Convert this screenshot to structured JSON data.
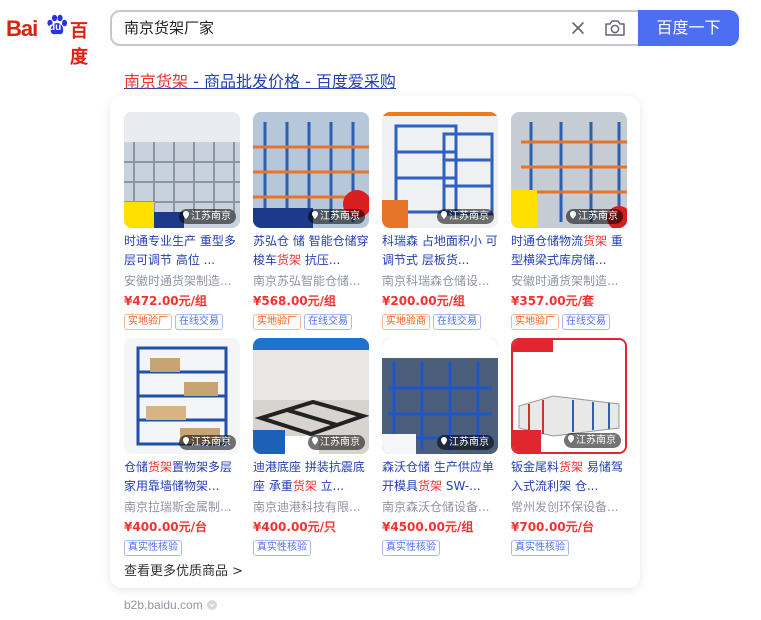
{
  "header": {
    "logo_text_en": "Bai",
    "logo_paw_text": "du",
    "logo_text_cn": "百度",
    "search_value": "南京货架厂家",
    "search_button": "百度一下"
  },
  "result": {
    "title_highlight": "南京货架",
    "title_rest": " - 商品批发价格 - 百度爱采购",
    "more_link": "查看更多优质商品 >",
    "source": "b2b.baidu.com"
  },
  "products": [
    {
      "title_a": "时通专业生产 重型多层可调节 高位 ...",
      "title_hl": "",
      "title_b": "",
      "company": "安徽时通货架制造...",
      "price": "¥472.00元/组",
      "location": "江苏南京",
      "tags": [
        "实地验厂",
        "在线交易"
      ],
      "tag_styles": [
        "orange",
        "blue"
      ]
    },
    {
      "title_a": "苏弘仓 储 智能仓储穿梭车",
      "title_hl": "货架",
      "title_b": " 抗压...",
      "company": "南京苏弘智能仓储...",
      "price": "¥568.00元/组",
      "location": "江苏南京",
      "tags": [
        "实地验厂",
        "在线交易"
      ],
      "tag_styles": [
        "orange",
        "blue"
      ]
    },
    {
      "title_a": "科瑞森 占地面积小 可调节式 层板货...",
      "title_hl": "",
      "title_b": "",
      "company": "南京科瑞森仓储设...",
      "price": "¥200.00元/组",
      "location": "江苏南京",
      "tags": [
        "实地验商",
        "在线交易"
      ],
      "tag_styles": [
        "orange",
        "blue"
      ]
    },
    {
      "title_a": "时通仓储物流",
      "title_hl": "货架",
      "title_b": " 重型横梁式库房储...",
      "company": "安徽时通货架制造...",
      "price": "¥357.00元/套",
      "location": "江苏南京",
      "tags": [
        "实地验厂",
        "在线交易"
      ],
      "tag_styles": [
        "orange",
        "blue"
      ]
    },
    {
      "title_a": "仓储",
      "title_hl": "货架",
      "title_b": "置物架多层家用靠墙储物架...",
      "company": "南京拉瑞斯金属制...",
      "price": "¥400.00元/台",
      "location": "江苏南京",
      "tags": [
        "真实性核验"
      ],
      "tag_styles": [
        "blue"
      ]
    },
    {
      "title_a": "迪港底座 拼装抗震底座 承重",
      "title_hl": "货架",
      "title_b": " 立...",
      "company": "南京迪港科技有限...",
      "price": "¥400.00元/只",
      "location": "江苏南京",
      "tags": [
        "真实性核验"
      ],
      "tag_styles": [
        "blue"
      ]
    },
    {
      "title_a": "森沃仓储 生产供应单开模具",
      "title_hl": "货架",
      "title_b": " SW-...",
      "company": "南京森沃仓储设备...",
      "price": "¥4500.00元/组",
      "location": "江苏南京",
      "tags": [
        "真实性核验"
      ],
      "tag_styles": [
        "blue"
      ]
    },
    {
      "title_a": "钣金尾料",
      "title_hl": "货架",
      "title_b": " 易储驾入式流利架 仓...",
      "company": "常州发创环保设备...",
      "price": "¥700.00元/台",
      "location": "江苏南京",
      "tags": [
        "真实性核验"
      ],
      "tag_styles": [
        "blue"
      ]
    }
  ],
  "colors": {
    "brand_blue": "#4e6ef2",
    "link_blue": "#2440b3",
    "highlight_red": "#f73131",
    "logo_red": "#de2010"
  },
  "icons": [
    "clear-icon",
    "camera-icon",
    "location-pin-icon",
    "chevron-down-icon"
  ]
}
